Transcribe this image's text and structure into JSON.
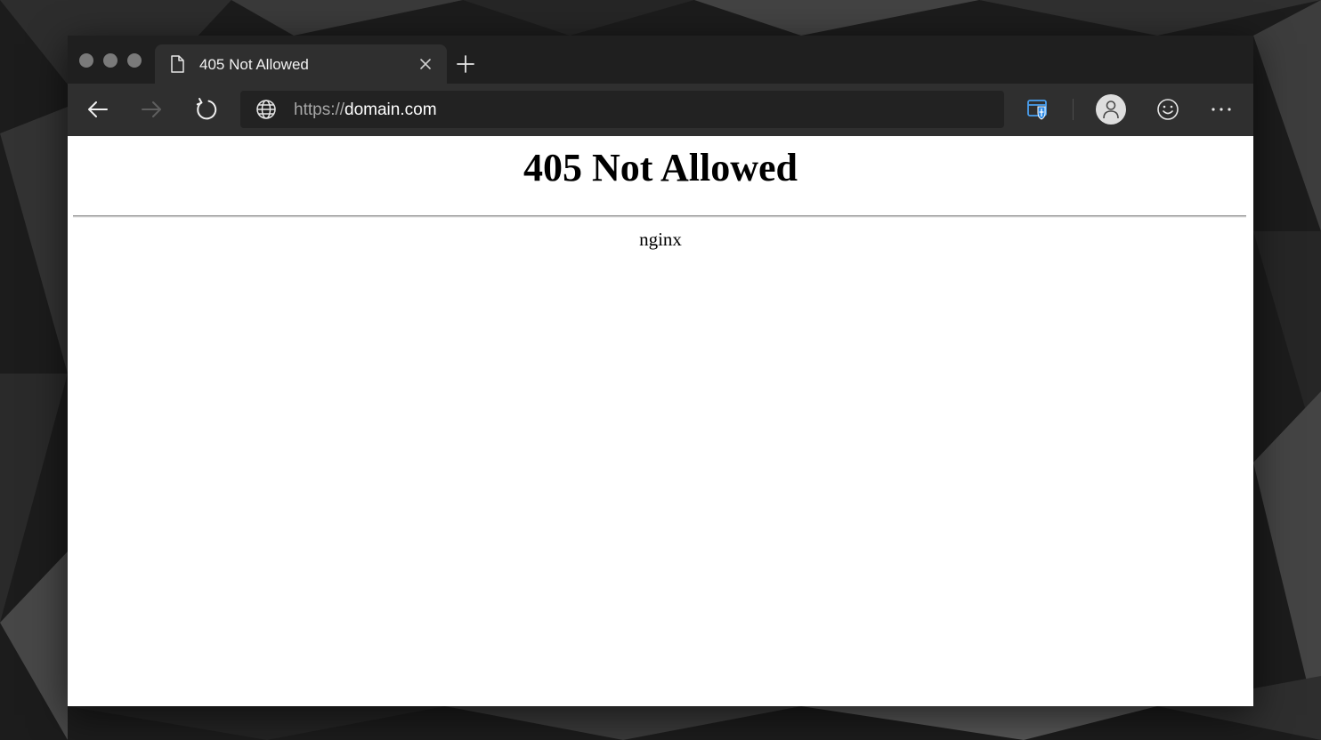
{
  "browser": {
    "tab": {
      "title": "405 Not Allowed"
    },
    "address_bar": {
      "url_scheme": "https://",
      "url_host": "domain.com"
    },
    "icons": {
      "tab_page": "page-icon",
      "tab_close": "close-icon",
      "new_tab": "plus-icon",
      "back": "arrow-left-icon",
      "forward": "arrow-right-icon",
      "refresh": "refresh-icon",
      "site": "globe-icon",
      "collections": "collections-icon",
      "profile": "user-icon",
      "feedback": "smiley-icon",
      "menu": "more-dots-icon"
    },
    "colors": {
      "tabstrip": "#1f1f1f",
      "toolbar": "#2f2f2f",
      "address_bg": "#222222",
      "collections_accent": "#2b8ae8"
    }
  },
  "page": {
    "heading": "405 Not Allowed",
    "server": "nginx"
  }
}
